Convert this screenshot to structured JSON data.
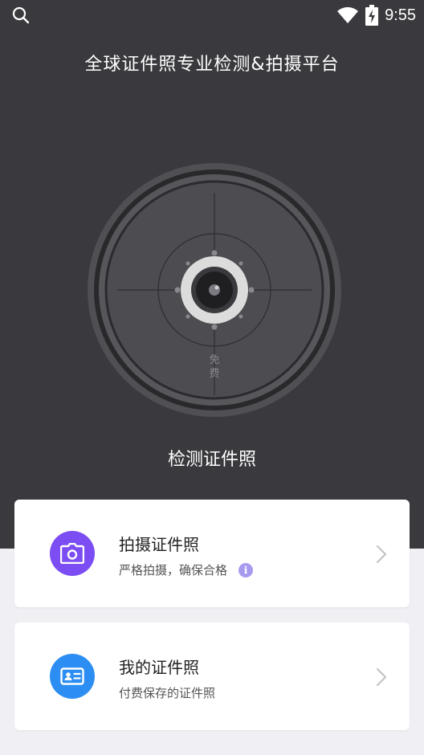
{
  "status": {
    "time": "9:55"
  },
  "header": {
    "title": "全球证件照专业检测&拍摄平台"
  },
  "dial": {
    "badge_text": "免费",
    "action_label": "检测证件照"
  },
  "cards": [
    {
      "title": "拍摄证件照",
      "subtitle": "严格拍摄，确保合格",
      "icon": "camera-icon",
      "icon_bg": "#7b4df2",
      "has_info": true
    },
    {
      "title": "我的证件照",
      "subtitle": "付费保存的证件照",
      "icon": "id-card-icon",
      "icon_bg": "#2c8ef2",
      "has_info": false
    }
  ],
  "colors": {
    "hero_bg": "#3a3a3e",
    "page_bg": "#efeff4",
    "camera_purple": "#7b4df2",
    "idcard_blue": "#2c8ef2",
    "info_badge": "#a79bf0"
  }
}
